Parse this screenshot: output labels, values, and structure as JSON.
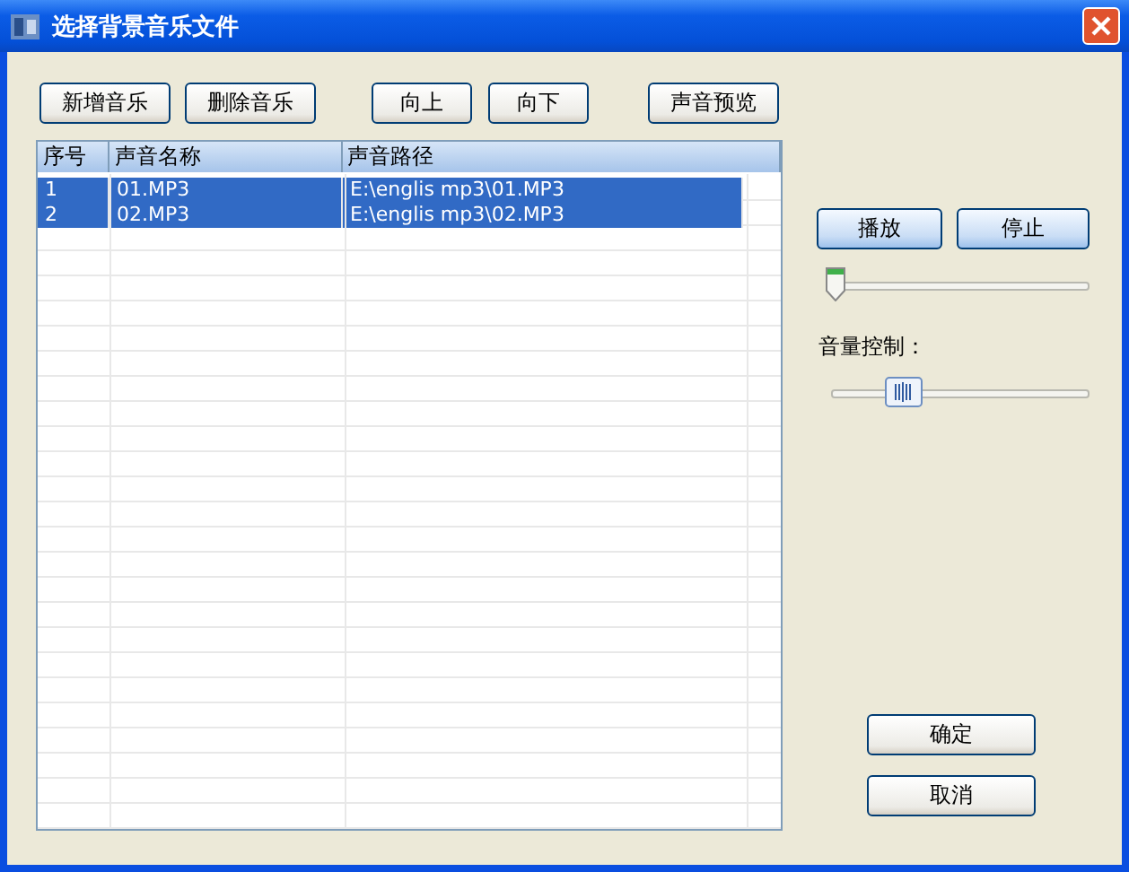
{
  "window": {
    "title": "选择背景音乐文件"
  },
  "toolbar": [
    "新增音乐",
    "删除音乐",
    "向上",
    "向下",
    "声音预览"
  ],
  "table": {
    "columns": [
      "序号",
      "声音名称",
      "声音路径"
    ],
    "rows": [
      {
        "cells": [
          "1",
          "01.MP3",
          "E:\\englis mp3\\01.MP3"
        ],
        "selected": true
      },
      {
        "cells": [
          "2",
          "02.MP3",
          "E:\\englis mp3\\02.MP3"
        ],
        "selected": true
      }
    ]
  },
  "player": {
    "buttons": [
      "播放",
      "停止"
    ],
    "position": {
      "level": 0
    },
    "volume_label": "音量控制：",
    "volume": {
      "level": 0.24
    }
  },
  "dialog_buttons": [
    "确定",
    "取消"
  ]
}
